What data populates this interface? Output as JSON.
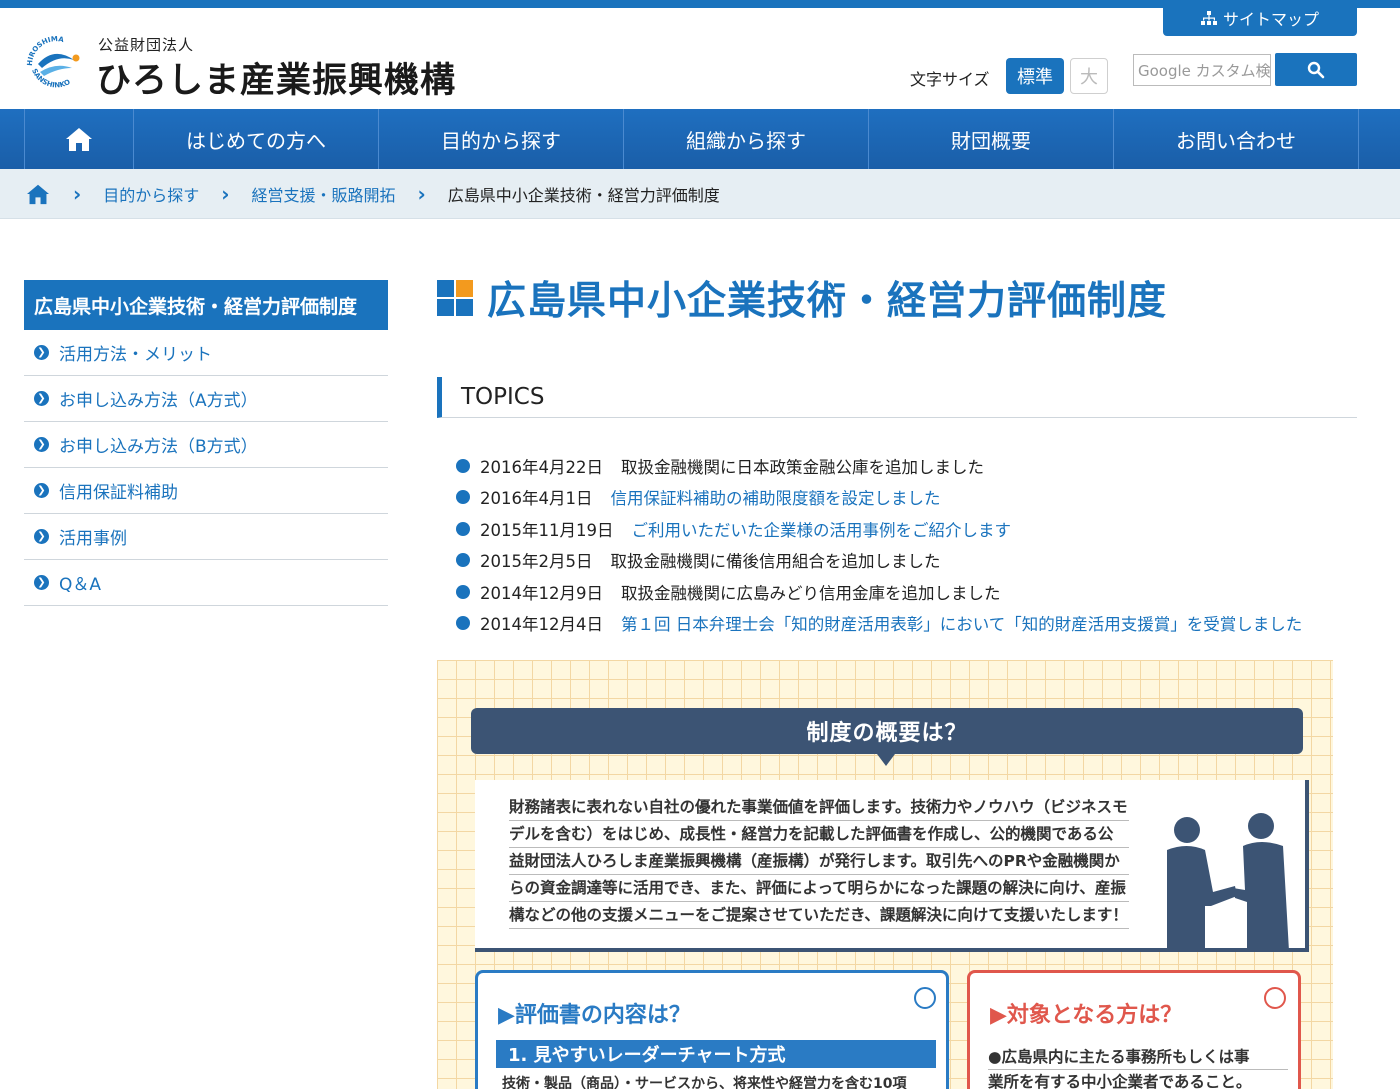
{
  "header": {
    "logo_sub": "公益財団法人",
    "logo_main": "ひろしま産業振興機構",
    "logo_mark_text_top": "HIROSHIMA",
    "logo_mark_text_bottom": "SANSHINKO",
    "sitemap_label": "サイトマップ",
    "font_size_label": "文字サイズ",
    "font_size_normal": "標準",
    "font_size_large": "大",
    "search_placeholder": "Google カスタム検索"
  },
  "nav": {
    "home_icon": "home-icon",
    "items": [
      {
        "label": "はじめての方へ"
      },
      {
        "label": "目的から探す"
      },
      {
        "label": "組織から探す"
      },
      {
        "label": "財団概要"
      },
      {
        "label": "お問い合わせ"
      }
    ]
  },
  "breadcrumb": {
    "home_icon": "home-icon",
    "items": [
      "目的から探す",
      "経営支援・販路開拓"
    ],
    "current": "広島県中小企業技術・経営力評価制度"
  },
  "sidebar": {
    "title": "広島県中小企業技術・経営力評価制度",
    "items": [
      {
        "label": "活用方法・メリット"
      },
      {
        "label": "お申し込み方法（A方式）"
      },
      {
        "label": "お申し込み方法（B方式）"
      },
      {
        "label": "信用保証料補助"
      },
      {
        "label": "活用事例"
      },
      {
        "label": "Q＆A"
      }
    ]
  },
  "main": {
    "title": "広島県中小企業技術・経営力評価制度",
    "topics_heading": "TOPICS",
    "topics": [
      {
        "date": "2016年4月22日",
        "text": "取扱金融機関に日本政策金融公庫を追加しました"
      },
      {
        "date": "2016年4月1日",
        "link": "信用保証料補助の補助限度額を設定しました"
      },
      {
        "date": "2015年11月19日",
        "link": "ご利用いただいた企業様の活用事例をご紹介します"
      },
      {
        "date": "2015年2月5日",
        "text": "取扱金融機関に備後信用組合を追加しました"
      },
      {
        "date": "2014年12月9日",
        "text": "取扱金融機関に広島みどり信用金庫を追加しました"
      },
      {
        "date": "2014年12月4日",
        "link": "第１回 日本弁理士会「知的財産活用表彰」において「知的財産活用支援賞」を受賞しました"
      }
    ]
  },
  "infographic": {
    "banner": "制度の概要は？",
    "lines": [
      "財務諸表に表れない自社の優れた事業価値を評価します。技術力やノウハウ（ビジネスモ",
      "デルを含む）をはじめ、成長性・経営力を記載した評価書を作成し、公的機関である公",
      "益財団法人ひろしま産業振興機構（産振構）が発行します。取引先へのPRや金融機関か",
      "らの資金調達等に活用でき、また、評価によって明らかになった課題の解決に向け、産振",
      "構などの他の支援メニューをご提案させていただき、課題解決に向けて支援いたします！"
    ],
    "card_left": {
      "title": "▶評価書の内容は？",
      "sub": "1. 見やすいレーダーチャート方式",
      "body": "技術・製品（商品）・サービスから、将来性や経営力を含む10項"
    },
    "card_right": {
      "title": "▶対象となる方は？",
      "lines": [
        "●広島県内に主たる事務所もしくは事",
        "業所を有する中小企業者であること。"
      ]
    },
    "colors": {
      "navy": "#3c5474",
      "blue": "#2a7bc4",
      "red": "#e0574c"
    }
  },
  "colors": {
    "accent": "#1a73bd",
    "breadcrumb_bg": "#e6eef3"
  }
}
